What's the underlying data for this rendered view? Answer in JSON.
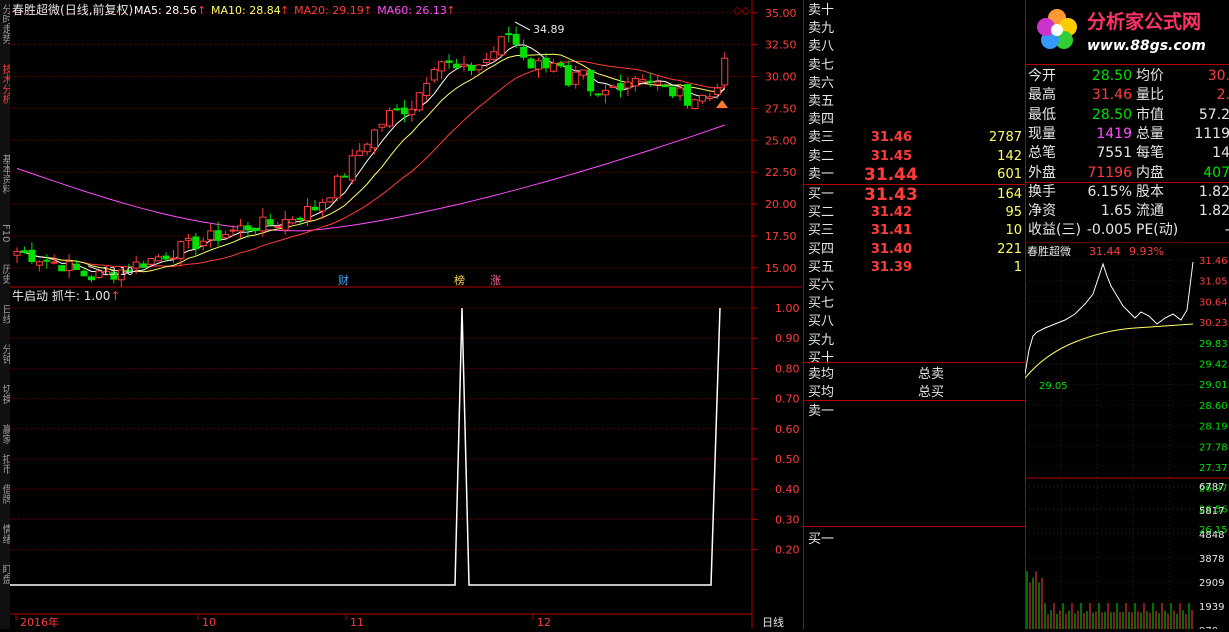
{
  "window": {
    "stock_name": "春胜超微",
    "period_mode": "(日线,前复权)"
  },
  "sidebar": {
    "tabs": [
      "分时走势",
      "技术分析",
      "基本资料",
      "F10",
      "历史",
      "日线",
      "分钟",
      "切换",
      "赢家",
      "扣币",
      "借牌",
      "情绪",
      "盯盘"
    ]
  },
  "main_chart": {
    "ma_labels": [
      {
        "text": "MA5: 28.56",
        "color": "#ffffff"
      },
      {
        "text": "MA10: 28.84",
        "color": "#ffff66"
      },
      {
        "text": "MA20: 29.19",
        "color": "#ff3c3c"
      },
      {
        "text": "MA60: 26.13",
        "color": "#ff4dff"
      }
    ],
    "high_marker": "34.89",
    "low_marker": "13.10",
    "event_markers": [
      "财",
      "榜",
      "涨"
    ],
    "y_ticks": [
      "35.00",
      "32.50",
      "30.00",
      "27.50",
      "25.00",
      "22.50",
      "20.00",
      "17.50",
      "15.00"
    ],
    "y_range": [
      13.5,
      36.0
    ]
  },
  "indicator": {
    "title": "牛启动",
    "param": "抓牛: 1.00",
    "y_ticks": [
      "1.00",
      "0.90",
      "0.80",
      "0.70",
      "0.60",
      "0.50",
      "0.40",
      "0.30",
      "0.20"
    ],
    "y_range": [
      0.0,
      1.0
    ]
  },
  "time_axis": {
    "labels": [
      "2016年",
      "10",
      "11",
      "12"
    ],
    "mode_label": "日线"
  },
  "orderbook": {
    "asks": [
      {
        "label": "卖十",
        "price": "",
        "vol": ""
      },
      {
        "label": "卖九",
        "price": "",
        "vol": ""
      },
      {
        "label": "卖八",
        "price": "",
        "vol": ""
      },
      {
        "label": "卖七",
        "price": "",
        "vol": ""
      },
      {
        "label": "卖六",
        "price": "",
        "vol": ""
      },
      {
        "label": "卖五",
        "price": "",
        "vol": ""
      },
      {
        "label": "卖四",
        "price": "",
        "vol": ""
      },
      {
        "label": "卖三",
        "price": "31.46",
        "vol": "2787"
      },
      {
        "label": "卖二",
        "price": "31.45",
        "vol": "142"
      },
      {
        "label": "卖一",
        "price": "31.44",
        "vol": "601"
      }
    ],
    "bids": [
      {
        "label": "买一",
        "price": "31.43",
        "vol": "164"
      },
      {
        "label": "买二",
        "price": "31.42",
        "vol": "95"
      },
      {
        "label": "买三",
        "price": "31.41",
        "vol": "10"
      },
      {
        "label": "买四",
        "price": "31.40",
        "vol": "221"
      },
      {
        "label": "买五",
        "price": "31.39",
        "vol": "1"
      },
      {
        "label": "买六",
        "price": "",
        "vol": ""
      },
      {
        "label": "买七",
        "price": "",
        "vol": ""
      },
      {
        "label": "买八",
        "price": "",
        "vol": ""
      },
      {
        "label": "买九",
        "price": "",
        "vol": ""
      },
      {
        "label": "买十",
        "price": "",
        "vol": ""
      }
    ],
    "ask_avg_label": "卖均",
    "bid_avg_label": "买均",
    "total_sell_label": "总卖",
    "total_buy_label": "总买",
    "ask1_label": "卖一",
    "bid1_label": "买一"
  },
  "logo": {
    "text": "分析家公式网",
    "url": "www.88gs.com"
  },
  "stats": [
    {
      "k1": "今开",
      "v1": "28.50",
      "c1": "green",
      "k2": "均价",
      "v2": "30.",
      "c2": "red"
    },
    {
      "k1": "最高",
      "v1": "31.46",
      "c1": "red",
      "k2": "量比",
      "v2": "2.",
      "c2": "red"
    },
    {
      "k1": "最低",
      "v1": "28.50",
      "c1": "green",
      "k2": "市值",
      "v2": "57.2",
      "c2": "white"
    },
    {
      "k1": "现量",
      "v1": "1419",
      "c1": "magenta",
      "k2": "总量",
      "v2": "1119",
      "c2": "white"
    },
    {
      "k1": "总笔",
      "v1": "7551",
      "c1": "white",
      "k2": "每笔",
      "v2": "14",
      "c2": "white"
    },
    {
      "k1": "外盘",
      "v1": "71196",
      "c1": "red",
      "k2": "内盘",
      "v2": "407",
      "c2": "green"
    },
    {
      "k1": "换手",
      "v1": "6.15%",
      "c1": "white",
      "k2": "股本",
      "v2": "1.82",
      "c2": "white"
    },
    {
      "k1": "净资",
      "v1": "1.65",
      "c1": "white",
      "k2": "流通",
      "v2": "1.82",
      "c2": "white"
    },
    {
      "k1": "收益(三)",
      "v1": "-0.005",
      "c1": "white",
      "k2": "PE(动)",
      "v2": "-",
      "c2": "white"
    }
  ],
  "minichart": {
    "stock_name": "春胜超微",
    "price": "31.44",
    "change": "9.93%",
    "open_marker": "29.05",
    "price_ticks": [
      "31.46",
      "31.05",
      "30.64",
      "30.23",
      "29.83",
      "29.42",
      "29.01",
      "28.60",
      "28.19",
      "27.78",
      "27.37",
      "26.97",
      "26.56",
      "26.15"
    ],
    "vol_ticks": [
      "6787",
      "5817",
      "4848",
      "3878",
      "2909",
      "1939",
      "970"
    ]
  },
  "colors": {
    "up": "#ff3c3c",
    "down": "#00e000",
    "ma5": "#ffffff",
    "ma10": "#ffff66",
    "ma20": "#ff3c3c",
    "ma60": "#ff4dff",
    "grid": "#8b0000"
  }
}
